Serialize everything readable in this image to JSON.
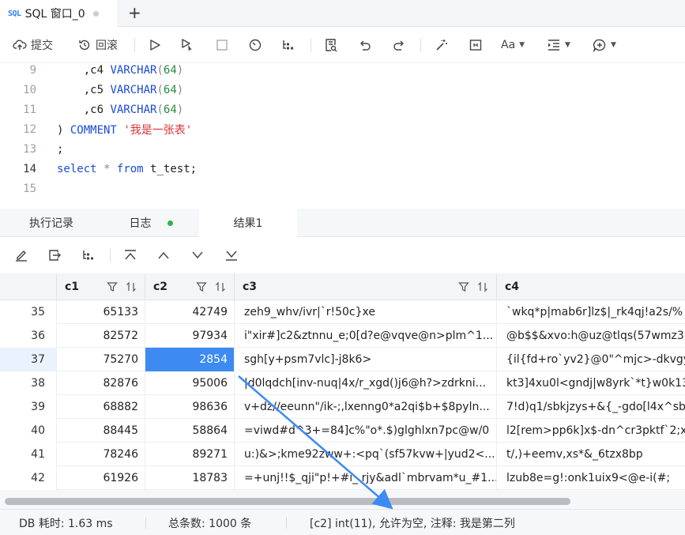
{
  "window_tab": {
    "badge": "SQL",
    "title": "SQL 窗口_0",
    "add_label": "+"
  },
  "toolbar": {
    "submit_label": "提交",
    "rollback_label": "回滚",
    "font_label": "Aa"
  },
  "editor": {
    "lines": [
      {
        "n": "9",
        "indent": "    ",
        "pre": ",c4 ",
        "kw": "VARCHAR",
        "num": "64"
      },
      {
        "n": "10",
        "indent": "    ",
        "pre": ",c5 ",
        "kw": "VARCHAR",
        "num": "64"
      },
      {
        "n": "11",
        "indent": "    ",
        "pre": ",c6 ",
        "kw": "VARCHAR",
        "num": "64"
      },
      {
        "n": "12",
        "comment_kw": "COMMENT",
        "str": "'我是一张表'"
      },
      {
        "n": "13",
        "text": ";"
      },
      {
        "n": "14",
        "select": "select",
        "star": "*",
        "from": "from",
        "table": "t_test;"
      },
      {
        "n": "15",
        "text": ""
      }
    ]
  },
  "result_tabs": [
    "执行记录",
    "日志",
    "结果1"
  ],
  "grid": {
    "columns": [
      "c1",
      "c2",
      "c3",
      "c4"
    ],
    "rows": [
      {
        "i": "35",
        "c1": "65133",
        "c2": "42749",
        "c3": "zeh9_whv/ivr|`r!50c}xe",
        "c4": "`wkq*p|mab6r]lz$|_rk4qj!a2s/%"
      },
      {
        "i": "36",
        "c1": "82572",
        "c2": "97934",
        "c3": "i\"xir#]c2&ztnnu_e;0[d?e@vqve@n>plm^1...",
        "c4": "@b$$&xvo:h@uz@tlqs(57wmz3"
      },
      {
        "i": "37",
        "c1": "75270",
        "c2": "2854",
        "c3": "sgh[y+psm7vlc]-j8k6>",
        "c4": "{il{fd+ro`yv2}@0\"^mjc>-dkvgy4"
      },
      {
        "i": "38",
        "c1": "82876",
        "c2": "95006",
        "c3": "|d0lqdch[inv-nuq|4x/r_xgd()j6@h?>zdrkni...",
        "c4": "kt3]4xu0l<gndj|w8yrk`*t}w0k13"
      },
      {
        "i": "39",
        "c1": "68882",
        "c2": "98636",
        "c3": "v+dz//eeunn\"/ik-;,lxenng0*a2qi$b+$8pyln...",
        "c4": "7!d)q1/sbkjzys+&{_-gdo[l4x^sb"
      },
      {
        "i": "40",
        "c1": "88445",
        "c2": "58864",
        "c3": "=viwd#d^3+=84]c%\"o*.$)glghlxn7pc@w/0",
        "c4": "l2[rem>pp6k]x$-dn^cr3pktf`2;x"
      },
      {
        "i": "41",
        "c1": "78246",
        "c2": "89271",
        "c3": "u:)&>;kme92zww+:<pq`(sf57kvw+|yud2<...",
        "c4": "t/,)+eemv,xs*&_6tzx8bp"
      },
      {
        "i": "42",
        "c1": "61926",
        "c2": "18783",
        "c3": "=+unj!!$_qji\"p!+#i_ rjy&adl`mbrvam*u_#1...",
        "c4": "lzub8e=g!:onk1uix9<@e-i(#;"
      }
    ]
  },
  "status": {
    "db_time": "DB 耗时: 1.63 ms",
    "total": "总条数: 1000 条",
    "column_info": "[c2] int(11), 允许为空, 注释: 我是第二列"
  },
  "colors": {
    "accent": "#3d8bf2",
    "keyword": "#1a4bd6",
    "number": "#2a8a3e",
    "string": "#d8343a",
    "status_dot": "#2fb34a"
  }
}
